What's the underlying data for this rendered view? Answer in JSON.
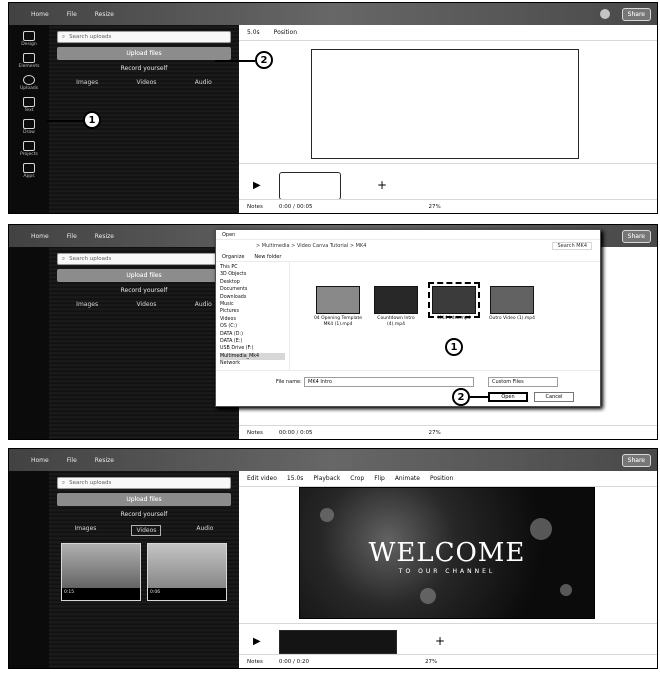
{
  "panel1": {
    "topbar": [
      "Home",
      "File",
      "Resize"
    ],
    "share": "Share",
    "search_placeholder": "Search uploads",
    "upload_button": "Upload files",
    "record": "Record yourself",
    "tabs": [
      "Images",
      "Videos",
      "Audio"
    ],
    "rail": [
      "Design",
      "Elements",
      "Uploads",
      "Text",
      "Draw",
      "Projects",
      "Apps"
    ],
    "edtool": [
      "5.0s",
      "Position"
    ],
    "status": [
      "Notes",
      "0:00 / 00:05",
      "27%"
    ],
    "callouts": [
      "1",
      "2"
    ]
  },
  "panel2": {
    "topbar": [
      "Home",
      "File",
      "Resize"
    ],
    "share": "Share",
    "search_placeholder": "Search uploads",
    "upload_button": "Upload files",
    "record": "Record yourself",
    "tabs": [
      "Images",
      "Videos",
      "Audio"
    ],
    "dialog": {
      "title": "Open",
      "address": "> Multimedia > Video Canva Tutorial > MK4",
      "search": "Search MK4",
      "organize": "Organize",
      "new_folder": "New folder",
      "nav": [
        "This PC",
        "3D Objects",
        "Desktop",
        "Documents",
        "Downloads",
        "Music",
        "Pictures",
        "Videos",
        "OS (C:)",
        "DATA (D:)",
        "DATA (E:)",
        "USB Drive (F:)",
        "Multimedia_Mk4",
        "Network"
      ],
      "files": [
        "04 Opening Template MK4 (1).mp4",
        "Countdown Intro (4).mp4",
        "MK4 Intro.mp4",
        "Outro Video (1).mp4"
      ],
      "filename_label": "File name:",
      "filename_value": "MK4 Intro",
      "filetype": "Custom Files",
      "open": "Open",
      "cancel": "Cancel"
    },
    "status": [
      "Notes",
      "00:00 / 0:05",
      "27%"
    ],
    "callouts": [
      "1",
      "2"
    ]
  },
  "panel3": {
    "topbar": [
      "Home",
      "File",
      "Resize"
    ],
    "share": "Share",
    "search_placeholder": "Search uploads",
    "upload_button": "Upload files",
    "record": "Record yourself",
    "tabs": [
      "Images",
      "Videos",
      "Audio"
    ],
    "edtool": [
      "Edit video",
      "15.0s",
      "Playback",
      "Crop",
      "Flip",
      "Animate",
      "Position"
    ],
    "welcome_big": "WELCOME",
    "welcome_small": "TO OUR CHANNEL",
    "thumbs": [
      "0:15",
      "0:06"
    ],
    "status": [
      "Notes",
      "0:00 / 0:20",
      "27%"
    ]
  }
}
